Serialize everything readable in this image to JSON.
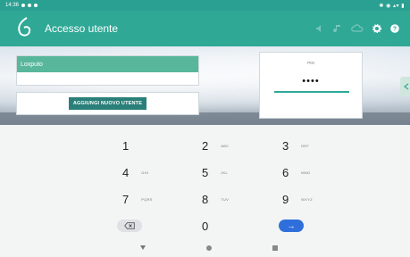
{
  "status_bar": {
    "time": "14:36",
    "right_icons": "✱ ◉ ▴▾ ▮"
  },
  "app": {
    "title": "Accesso utente",
    "accent_color": "#2fa896"
  },
  "toolbar_icons": [
    "volume-icon",
    "music-icon",
    "cloud-icon",
    "gear-icon",
    "help-icon"
  ],
  "users": {
    "selected_user": "Loxputo",
    "add_user_label": "AGGIUNGI NUOVO UTENTE"
  },
  "pin": {
    "label": "PIN",
    "masked_value": "••••"
  },
  "keypad": {
    "keys": [
      {
        "num": "1",
        "letters": ""
      },
      {
        "num": "2",
        "letters": "ABC"
      },
      {
        "num": "3",
        "letters": "DEF"
      },
      {
        "num": "4",
        "letters": "GHI"
      },
      {
        "num": "5",
        "letters": "JKL"
      },
      {
        "num": "6",
        "letters": "MNO"
      },
      {
        "num": "7",
        "letters": "PQRS"
      },
      {
        "num": "8",
        "letters": "TUV"
      },
      {
        "num": "9",
        "letters": "WXYZ"
      },
      {
        "num": "0",
        "letters": ""
      }
    ],
    "enter_symbol": "→"
  }
}
